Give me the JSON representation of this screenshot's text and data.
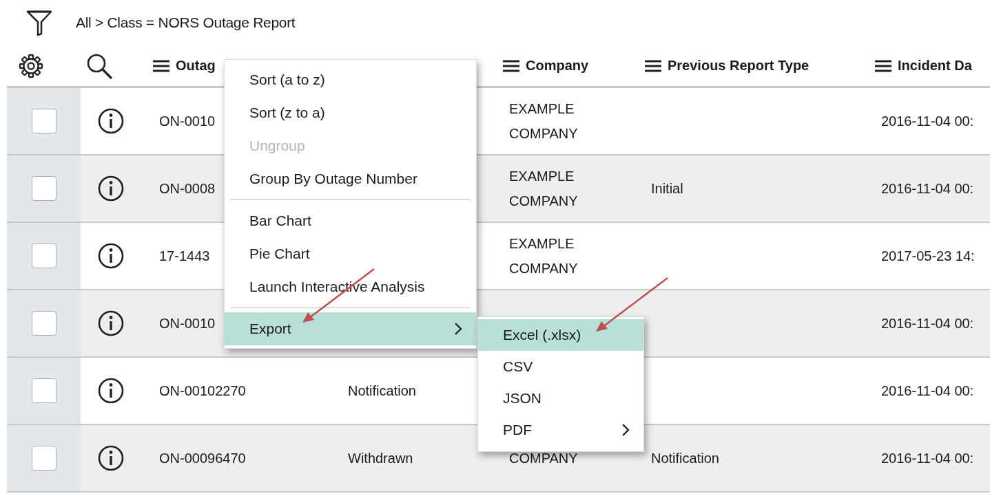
{
  "filter_breadcrumb": "All > Class = NORS Outage Report",
  "table": {
    "header": {
      "outage": "Outag",
      "company": "Company",
      "previous_report_type": "Previous Report Type",
      "incident_date": "Incident Da"
    },
    "rows": [
      {
        "checked": false,
        "outage_number": "ON-0010",
        "company": "EXAMPLE COMPANY",
        "incident_date": "2016-11-04 00:"
      },
      {
        "checked": false,
        "outage_number": "ON-0008",
        "company": "EXAMPLE COMPANY",
        "previous_report_type": "Initial",
        "incident_date": "2016-11-04 00:"
      },
      {
        "checked": false,
        "outage_number": "17-1443",
        "company": "EXAMPLE COMPANY",
        "incident_date": "2017-05-23 14:"
      },
      {
        "checked": false,
        "outage_number": "ON-0010",
        "incident_date": "2016-11-04 00:"
      },
      {
        "checked": false,
        "outage_number": "ON-00102270",
        "column_2": "Notification",
        "incident_date": "2016-11-04 00:"
      },
      {
        "checked": false,
        "outage_number": "ON-00096470",
        "column_2": "Withdrawn",
        "company": "COMPANY",
        "previous_report_type": "Notification",
        "incident_date": "2016-11-04 00:"
      }
    ]
  },
  "column_menu": {
    "items": [
      {
        "kind": "item",
        "label": "Sort (a to z)",
        "disabled": false,
        "selected": false,
        "has_submenu": false
      },
      {
        "kind": "item",
        "label": "Sort (z to a)",
        "disabled": false,
        "selected": false,
        "has_submenu": false
      },
      {
        "kind": "item",
        "label": "Ungroup",
        "disabled": true,
        "selected": false,
        "has_submenu": false
      },
      {
        "kind": "item",
        "label": "Group By Outage Number",
        "disabled": false,
        "selected": false,
        "has_submenu": false
      },
      {
        "kind": "divider"
      },
      {
        "kind": "item",
        "label": "Bar Chart",
        "disabled": false,
        "selected": false,
        "has_submenu": false
      },
      {
        "kind": "item",
        "label": "Pie Chart",
        "disabled": false,
        "selected": false,
        "has_submenu": false
      },
      {
        "kind": "item",
        "label": "Launch Interactive Analysis",
        "disabled": false,
        "selected": false,
        "has_submenu": false
      },
      {
        "kind": "divider"
      },
      {
        "kind": "item",
        "label": "Export",
        "disabled": false,
        "selected": true,
        "has_submenu": true
      }
    ]
  },
  "export_submenu": {
    "items": [
      {
        "label": "Excel (.xlsx)",
        "selected": true,
        "has_submenu": false
      },
      {
        "label": "CSV",
        "selected": false,
        "has_submenu": false
      },
      {
        "label": "JSON",
        "selected": false,
        "has_submenu": false
      },
      {
        "label": "PDF",
        "selected": false,
        "has_submenu": true
      }
    ]
  }
}
